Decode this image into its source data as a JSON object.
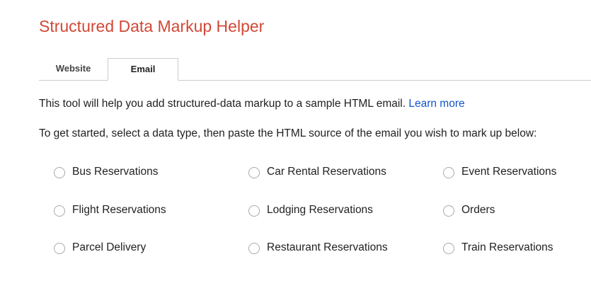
{
  "header": {
    "title": "Structured Data Markup Helper"
  },
  "tabs": [
    {
      "label": "Website",
      "selected": false
    },
    {
      "label": "Email",
      "selected": true
    }
  ],
  "intro": {
    "text": "This tool will help you add structured-data markup to a sample HTML email.",
    "link_text": "Learn more"
  },
  "instructions": "To get started, select a data type, then paste the HTML source of the email you wish to mark up below:",
  "data_types": [
    {
      "label": "Bus Reservations",
      "selected": false
    },
    {
      "label": "Car Rental Reservations",
      "selected": false
    },
    {
      "label": "Event Reservations",
      "selected": false
    },
    {
      "label": "Flight Reservations",
      "selected": false
    },
    {
      "label": "Lodging Reservations",
      "selected": false
    },
    {
      "label": "Orders",
      "selected": false
    },
    {
      "label": "Parcel Delivery",
      "selected": false
    },
    {
      "label": "Restaurant Reservations",
      "selected": false
    },
    {
      "label": "Train Reservations",
      "selected": false
    }
  ],
  "colors": {
    "title": "#d14836",
    "link": "#1155cc",
    "text": "#222222",
    "border": "#cccccc"
  }
}
